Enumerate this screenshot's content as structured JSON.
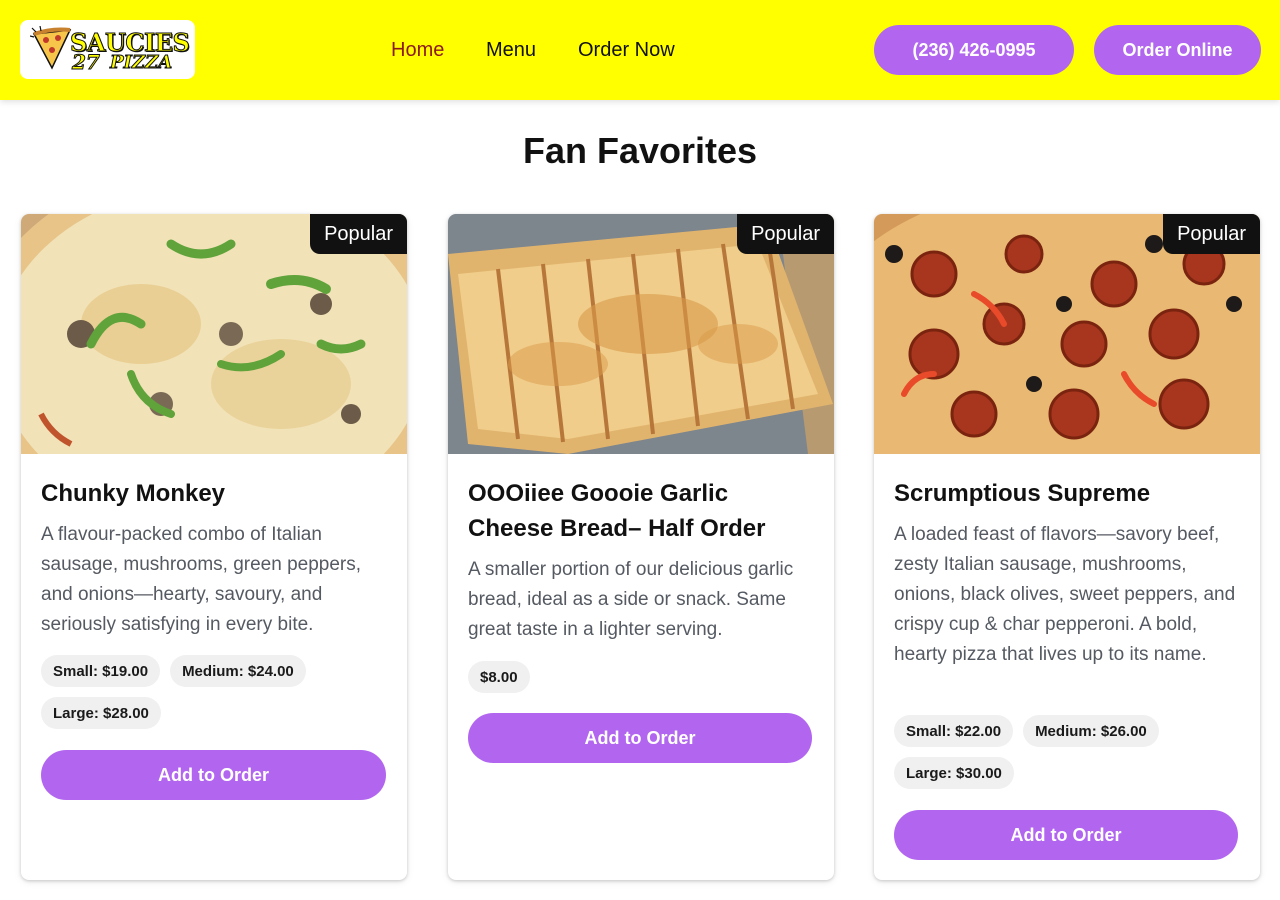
{
  "header": {
    "logo": {
      "word": "SAUCIES",
      "number": "27",
      "sub": "PIZZA"
    },
    "nav": [
      {
        "label": "Home",
        "active": true
      },
      {
        "label": "Menu",
        "active": false
      },
      {
        "label": "Order Now",
        "active": false
      }
    ],
    "phone_label": "(236) 426-0995",
    "order_online_label": "Order Online"
  },
  "section": {
    "title": "Fan Favorites"
  },
  "cards": [
    {
      "badge": "Popular",
      "title": "Chunky Monkey",
      "description": "A flavour-packed combo of Italian sausage, mushrooms, green peppers, and onions—hearty, savoury, and seriously satisfying in every bite.",
      "prices": [
        "Small: $19.00",
        "Medium: $24.00",
        "Large: $28.00"
      ],
      "button": "Add to Order"
    },
    {
      "badge": "Popular",
      "title": "OOOiiee Goooie Garlic Cheese Bread– Half Order",
      "description": "A smaller portion of our delicious garlic bread, ideal as a side or snack. Same great taste in a lighter serving.",
      "prices": [
        "$8.00"
      ],
      "button": "Add to Order"
    },
    {
      "badge": "Popular",
      "title": "Scrumptious Supreme",
      "description": "A loaded feast of flavors—savory beef, zesty Italian sausage, mushrooms, onions, black olives, sweet peppers, and crispy cup & char pepperoni. A bold, hearty pizza that lives up to its name.",
      "prices": [
        "Small: $22.00",
        "Medium: $26.00",
        "Large: $30.00"
      ],
      "button": "Add to Order"
    }
  ],
  "colors": {
    "header_bg": "#ffff00",
    "accent": "#b266f0",
    "active_nav": "#8b1a1a",
    "badge_bg": "#111111"
  }
}
